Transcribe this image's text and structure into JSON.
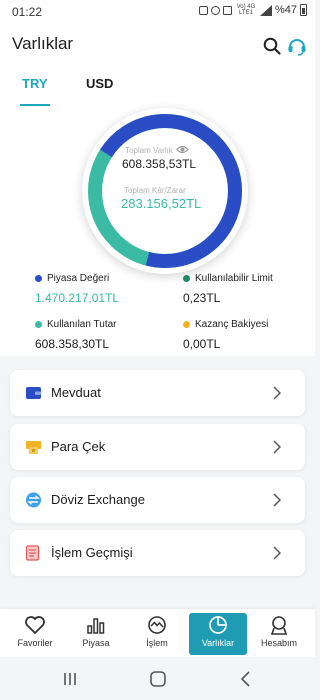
{
  "status_bar": {
    "time": "01:22",
    "network": "Vo) 4G LTE1",
    "battery": "%47"
  },
  "header": {
    "title": "Varlıklar"
  },
  "tabs": [
    {
      "label": "TRY",
      "active": true
    },
    {
      "label": "USD",
      "active": false
    }
  ],
  "summary": {
    "total_assets_label": "Toplam Varlık",
    "total_assets_value": "608.358,53TL",
    "total_pl_label": "Toplam Kâr/Zarar",
    "total_pl_value": "283.156,52TL"
  },
  "donut_levels": {
    "used_share": 0.7,
    "colors": {
      "used": "#2a4dc6",
      "available": "#3bbba3",
      "profit": "#3bbba3",
      "limit": "#1f8a63",
      "bonus": "#f3b423"
    }
  },
  "legend": [
    {
      "label": "Piyasa Değeri",
      "value": "1.470.217,01TL",
      "color": "#2a4dc6"
    },
    {
      "label": "Kullanılabilir Limit",
      "value": "0,23TL",
      "color": "#1f8a63"
    },
    {
      "label": "Kullanılan Tutar",
      "value": "608.358,30TL",
      "color": "#3bbba3"
    },
    {
      "label": "Kazanç Bakiyesi",
      "value": "0,00TL",
      "color": "#f3b423"
    }
  ],
  "menu": [
    {
      "label": "Mevduat",
      "icon": "wallet-icon"
    },
    {
      "label": "Para Çek",
      "icon": "withdraw-icon"
    },
    {
      "label": "Döviz Exchange",
      "icon": "exchange-icon"
    },
    {
      "label": "İşlem Geçmişi",
      "icon": "history-icon"
    }
  ],
  "bottom_nav": [
    {
      "label": "Favoriler",
      "icon": "heart-icon"
    },
    {
      "label": "Piyasa",
      "icon": "bar-chart-icon"
    },
    {
      "label": "İşlem",
      "icon": "trade-icon"
    },
    {
      "label": "Varlıklar",
      "icon": "pie-chart-icon",
      "active": true
    },
    {
      "label": "Hesabım",
      "icon": "account-icon"
    }
  ]
}
